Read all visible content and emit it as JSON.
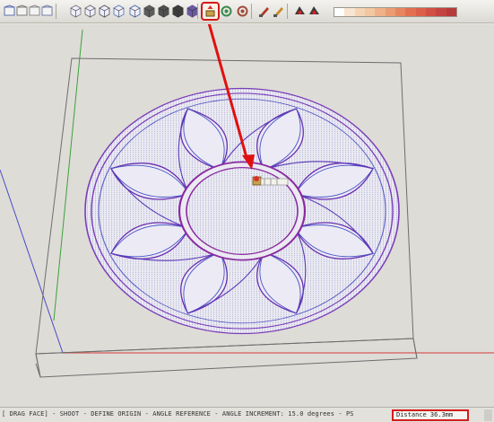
{
  "toolbar": {
    "tools": [
      {
        "name": "save-icon"
      },
      {
        "name": "home-view-icon"
      },
      {
        "name": "front-view-icon"
      },
      {
        "name": "iso-view-icon"
      },
      {
        "name": "top-view-icon"
      },
      {
        "name": "right-view-icon"
      },
      {
        "name": "back-view-icon"
      },
      {
        "name": "left-view-icon"
      },
      {
        "name": "xray-style-icon"
      },
      {
        "name": "wireframe-style-icon"
      },
      {
        "name": "shaded-style-icon"
      },
      {
        "name": "textured-style-icon"
      },
      {
        "name": "monochrome-style-icon"
      },
      {
        "name": "pushpull-tool-icon",
        "selected": true
      },
      {
        "name": "followme-tool-icon"
      },
      {
        "name": "offset-tool-icon"
      },
      {
        "name": "paint-tool-icon"
      },
      {
        "name": "eraser-tool-icon"
      },
      {
        "name": "section-plane-icon"
      },
      {
        "name": "section-display-icon"
      }
    ],
    "selected_tool": "pushpull-tool-icon",
    "accent_color": "#d21b1b"
  },
  "statusbar": {
    "hint": "[ DRAG FACE] - SHOOT - DEFINE ORIGIN - ANGLE REFERENCE - ANGLE INCREMENT: 15.0 degrees - PS",
    "vcb": "Distance 36.3mm"
  }
}
